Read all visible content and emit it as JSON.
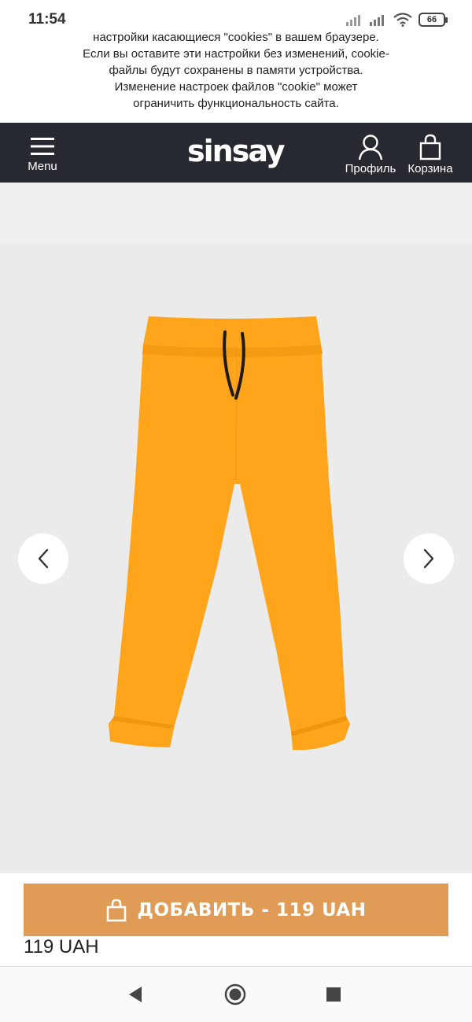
{
  "status_bar": {
    "time": "11:54",
    "battery": "66",
    "icons": [
      "signal-icon",
      "signal-icon",
      "wifi-icon",
      "battery-icon"
    ]
  },
  "cookie_notice": {
    "lines": [
      "настройки касающиеся \"cookies\" в вашем браузере.",
      "Если вы оставите эти настройки без изменений, cookie-",
      "файлы будут сохранены в памяти устройства.",
      "Изменение настроек файлов \"cookie\" может",
      "ограничить функциональность сайта."
    ]
  },
  "header": {
    "menu_label": "Menu",
    "logo": "sinsay",
    "profile_label": "Профиль",
    "cart_label": "Корзина"
  },
  "gallery": {
    "product_color": "#ffa51c",
    "prev_icon": "chevron-left-icon",
    "next_icon": "chevron-right-icon"
  },
  "product": {
    "add_to_cart_label": "ДОБАВИТЬ - 119 UAH",
    "price": "119 UAH"
  },
  "colors": {
    "header_bg": "#26292f",
    "button_bg": "#e09b56",
    "gallery_bg": "#ebebeb"
  },
  "nav_bar": {
    "back_icon": "back-triangle-icon",
    "home_icon": "home-circle-icon",
    "recents_icon": "recents-square-icon"
  }
}
